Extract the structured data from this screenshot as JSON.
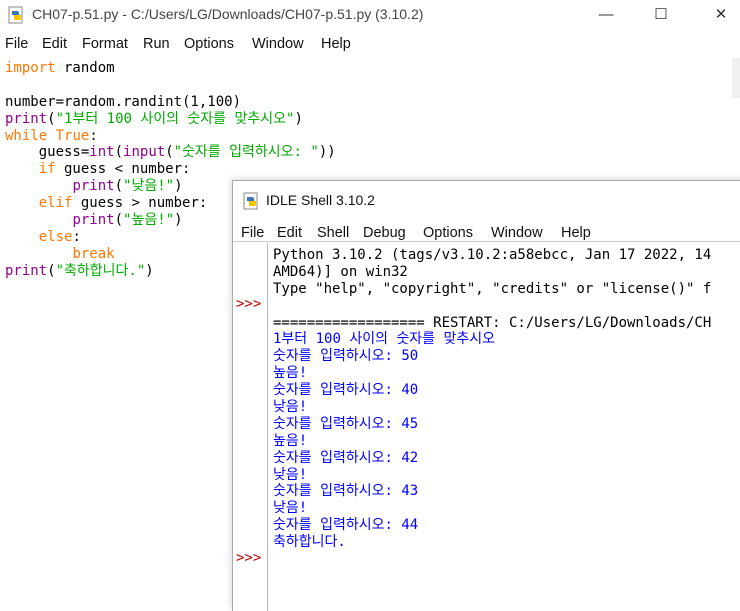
{
  "editor": {
    "title": "CH07-p.51.py - C:/Users/LG/Downloads/CH07-p.51.py (3.10.2)",
    "menu": [
      "File",
      "Edit",
      "Format",
      "Run",
      "Options",
      "Window",
      "Help"
    ],
    "code": [
      [
        {
          "t": "import",
          "c": "kw"
        },
        {
          "t": " random",
          "c": ""
        }
      ],
      [
        {
          "t": "",
          "c": ""
        }
      ],
      [
        {
          "t": "number=random.randint(1,100)",
          "c": ""
        }
      ],
      [
        {
          "t": "print",
          "c": "bi"
        },
        {
          "t": "(",
          "c": ""
        },
        {
          "t": "\"1부터 100 사이의 숫자를 맞추시오\"",
          "c": "str"
        },
        {
          "t": ")",
          "c": ""
        }
      ],
      [
        {
          "t": "while",
          "c": "kw"
        },
        {
          "t": " ",
          "c": ""
        },
        {
          "t": "True",
          "c": "kw"
        },
        {
          "t": ":",
          "c": ""
        }
      ],
      [
        {
          "t": "    guess=",
          "c": ""
        },
        {
          "t": "int",
          "c": "bi"
        },
        {
          "t": "(",
          "c": ""
        },
        {
          "t": "input",
          "c": "bi"
        },
        {
          "t": "(",
          "c": ""
        },
        {
          "t": "\"숫자를 입력하시오: \"",
          "c": "str"
        },
        {
          "t": "))",
          "c": ""
        }
      ],
      [
        {
          "t": "    ",
          "c": ""
        },
        {
          "t": "if",
          "c": "kw"
        },
        {
          "t": " guess < number:",
          "c": ""
        }
      ],
      [
        {
          "t": "        ",
          "c": ""
        },
        {
          "t": "print",
          "c": "bi"
        },
        {
          "t": "(",
          "c": ""
        },
        {
          "t": "\"낮음!\"",
          "c": "str"
        },
        {
          "t": ")",
          "c": ""
        }
      ],
      [
        {
          "t": "    ",
          "c": ""
        },
        {
          "t": "elif",
          "c": "kw"
        },
        {
          "t": " guess > number:",
          "c": ""
        }
      ],
      [
        {
          "t": "        ",
          "c": ""
        },
        {
          "t": "print",
          "c": "bi"
        },
        {
          "t": "(",
          "c": ""
        },
        {
          "t": "\"높음!\"",
          "c": "str"
        },
        {
          "t": ")",
          "c": ""
        }
      ],
      [
        {
          "t": "    ",
          "c": ""
        },
        {
          "t": "else",
          "c": "kw"
        },
        {
          "t": ":",
          "c": ""
        }
      ],
      [
        {
          "t": "        ",
          "c": ""
        },
        {
          "t": "break",
          "c": "kw"
        }
      ],
      [
        {
          "t": "print",
          "c": "bi"
        },
        {
          "t": "(",
          "c": ""
        },
        {
          "t": "\"축하합니다.\"",
          "c": "str"
        },
        {
          "t": ")",
          "c": ""
        }
      ]
    ]
  },
  "shell": {
    "title": "IDLE Shell 3.10.2",
    "menu": [
      "File",
      "Edit",
      "Shell",
      "Debug",
      "Options",
      "Window",
      "Help"
    ],
    "prompt": ">>>",
    "output": [
      {
        "t": "Python 3.10.2 (tags/v3.10.2:a58ebcc, Jan 17 2022, 14",
        "c": ""
      },
      {
        "t": "AMD64)] on win32",
        "c": ""
      },
      {
        "t": "Type \"help\", \"copyright\", \"credits\" or \"license()\" f",
        "c": ""
      },
      {
        "t": "",
        "c": ""
      },
      {
        "t": "================== RESTART: C:/Users/LG/Downloads/CH",
        "c": ""
      },
      {
        "t": "1부터 100 사이의 숫자를 맞추시오",
        "c": "stdout"
      },
      {
        "t": "숫자를 입력하시오: 50",
        "c": "stdout"
      },
      {
        "t": "높음!",
        "c": "stdout"
      },
      {
        "t": "숫자를 입력하시오: 40",
        "c": "stdout"
      },
      {
        "t": "낮음!",
        "c": "stdout"
      },
      {
        "t": "숫자를 입력하시오: 45",
        "c": "stdout"
      },
      {
        "t": "높음!",
        "c": "stdout"
      },
      {
        "t": "숫자를 입력하시오: 42",
        "c": "stdout"
      },
      {
        "t": "낮음!",
        "c": "stdout"
      },
      {
        "t": "숫자를 입력하시오: 43",
        "c": "stdout"
      },
      {
        "t": "낮음!",
        "c": "stdout"
      },
      {
        "t": "숫자를 입력하시오: 44",
        "c": "stdout"
      },
      {
        "t": "축하합니다.",
        "c": "stdout"
      }
    ]
  },
  "window_controls": {
    "minimize": "—",
    "maximize": "☐",
    "close": "✕"
  }
}
